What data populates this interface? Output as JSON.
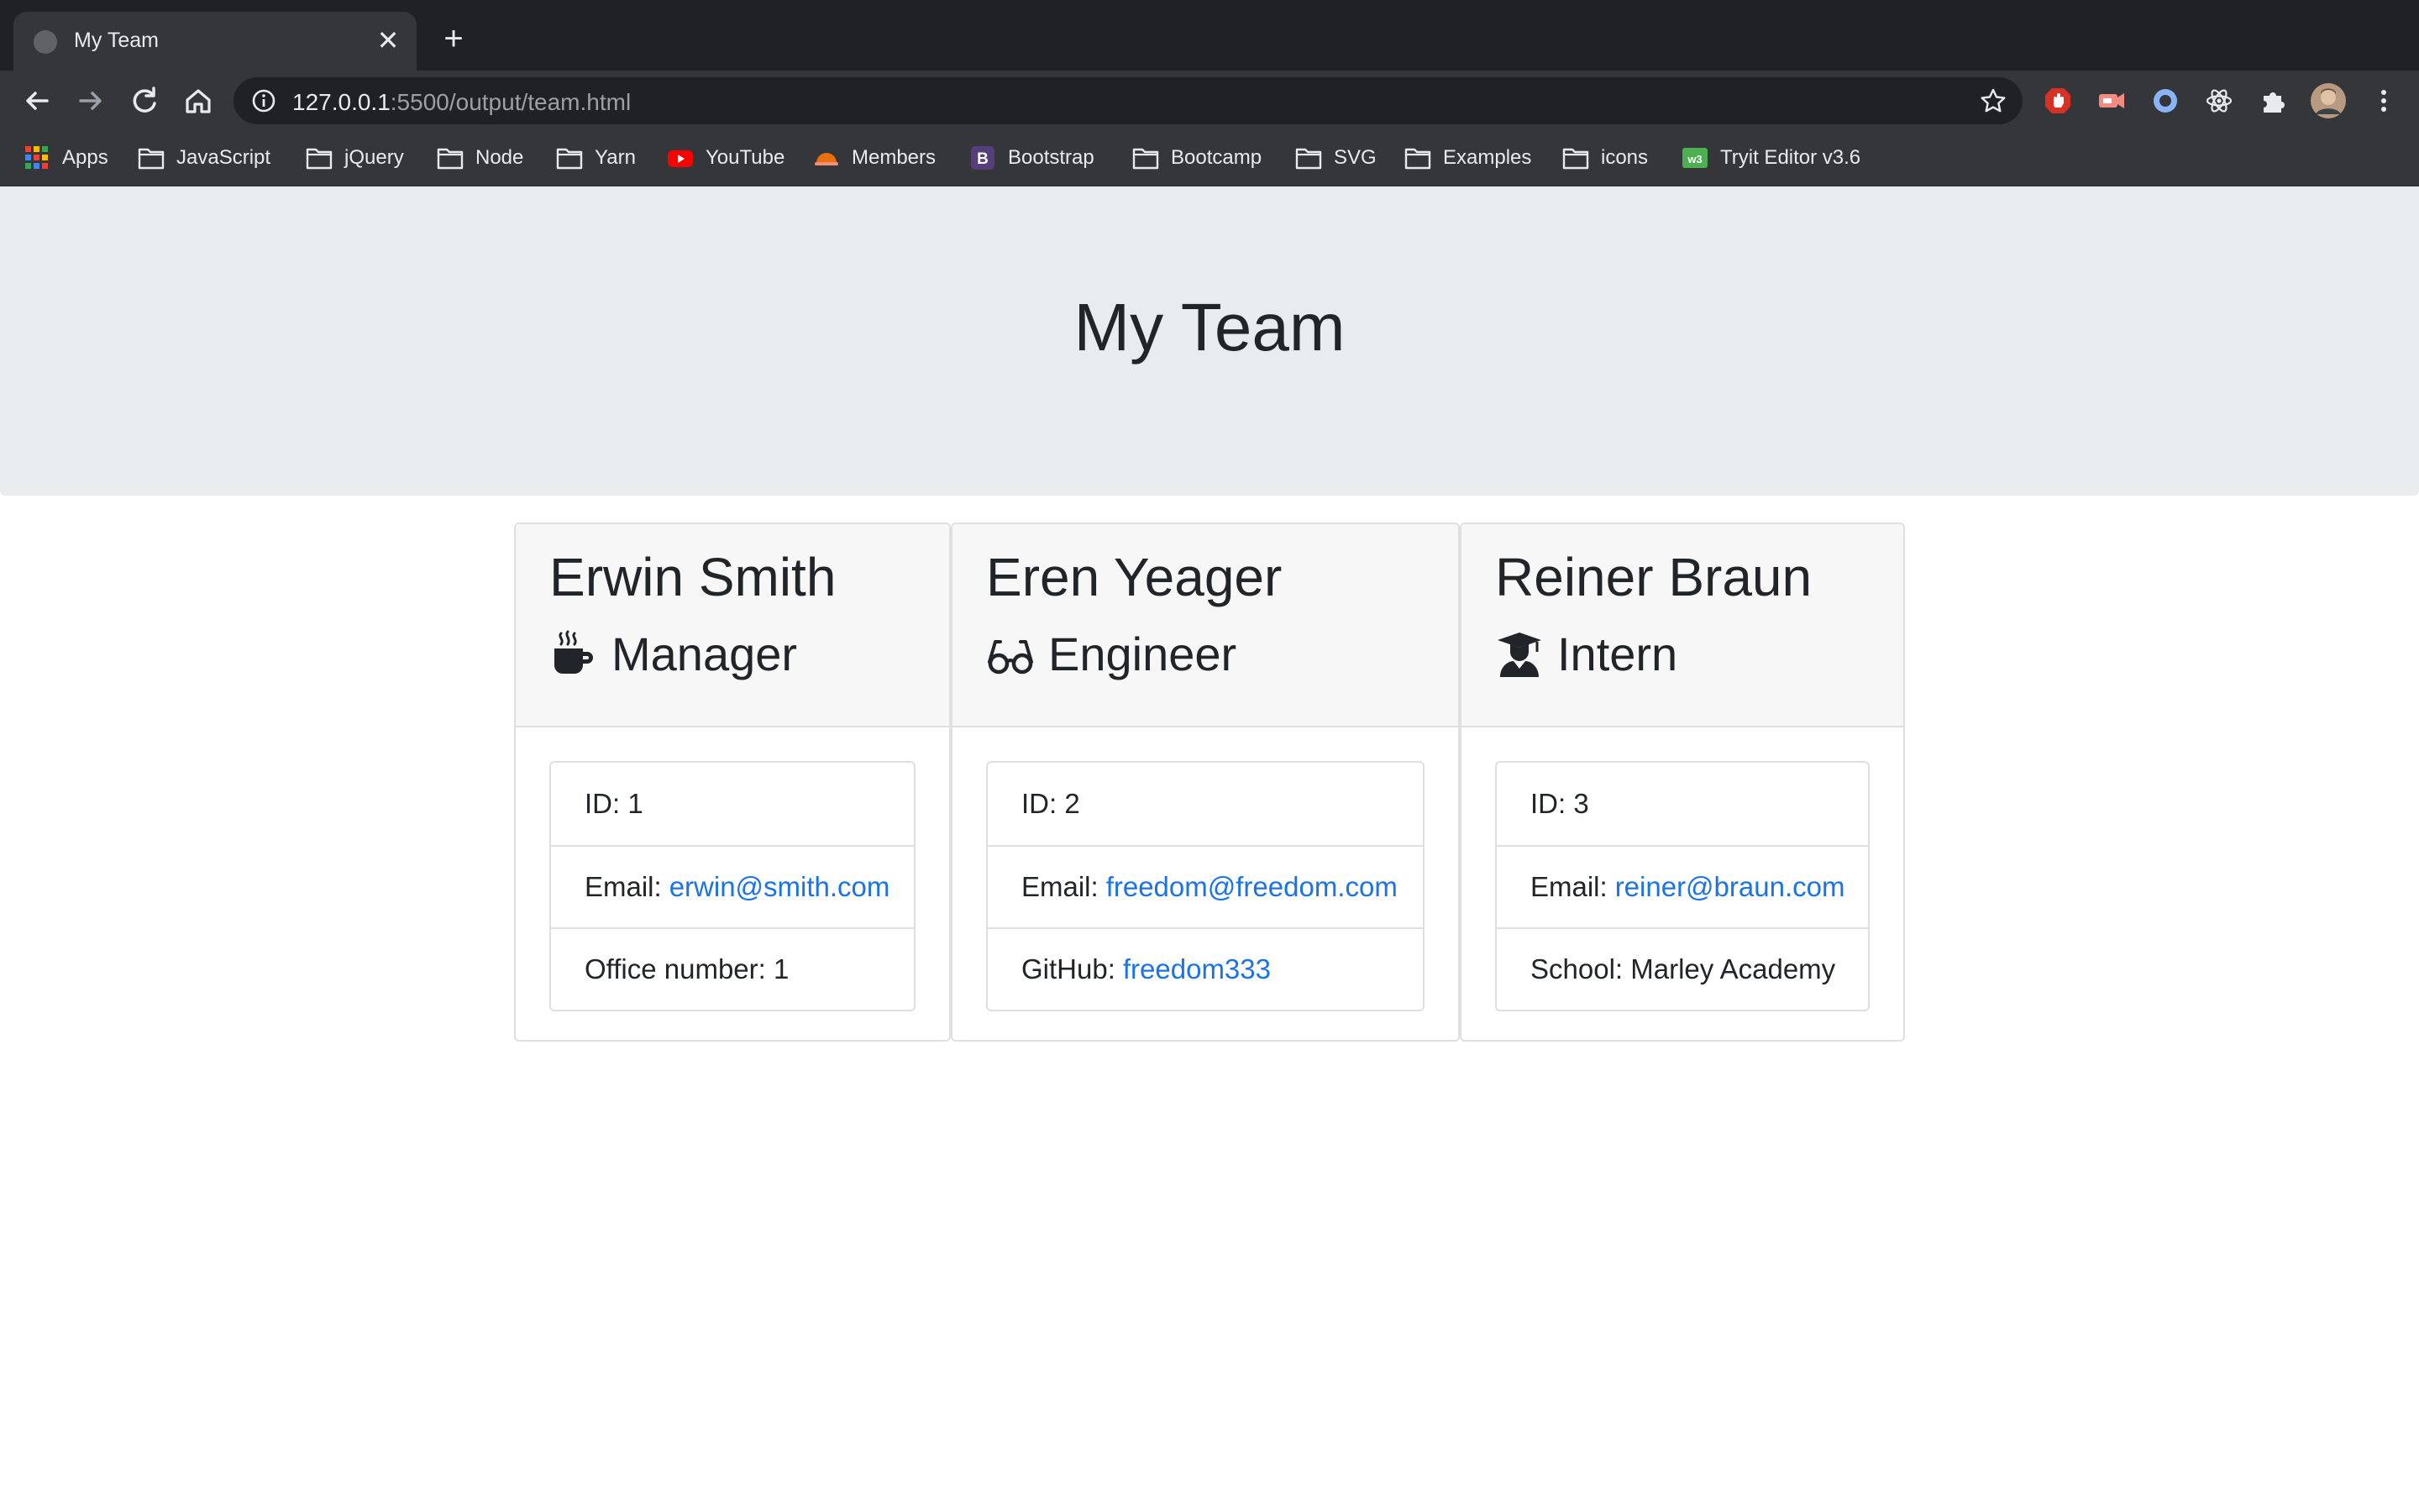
{
  "browser": {
    "tab_title": "My Team",
    "url_host": "127.0.0.1",
    "url_rest": ":5500/output/team.html",
    "bookmarks": [
      {
        "label": "Apps",
        "icon": "apps-grid-icon"
      },
      {
        "label": "JavaScript",
        "icon": "folder-icon"
      },
      {
        "label": "jQuery",
        "icon": "folder-icon"
      },
      {
        "label": "Node",
        "icon": "folder-icon"
      },
      {
        "label": "Yarn",
        "icon": "folder-icon"
      },
      {
        "label": "YouTube",
        "icon": "youtube-icon"
      },
      {
        "label": "Members",
        "icon": "helmet-icon"
      },
      {
        "label": "Bootstrap",
        "icon": "bootstrap-icon"
      },
      {
        "label": "Bootcamp",
        "icon": "folder-icon"
      },
      {
        "label": "SVG",
        "icon": "folder-icon"
      },
      {
        "label": "Examples",
        "icon": "folder-icon"
      },
      {
        "label": "icons",
        "icon": "folder-icon"
      },
      {
        "label": "Tryit Editor v3.6",
        "icon": "w3schools-icon"
      }
    ]
  },
  "page": {
    "heading": "My Team",
    "members": [
      {
        "name": "Erwin Smith",
        "role": "Manager",
        "role_icon": "mug-icon",
        "id_label": "ID:",
        "id_value": "1",
        "email_label": "Email:",
        "email": "erwin@smith.com",
        "extra_label": "Office number:",
        "extra_value": "1"
      },
      {
        "name": "Eren Yeager",
        "role": "Engineer",
        "role_icon": "glasses-icon",
        "id_label": "ID:",
        "id_value": "2",
        "email_label": "Email:",
        "email": "freedom@freedom.com",
        "extra_label": "GitHub:",
        "extra_value": "freedom333"
      },
      {
        "name": "Reiner Braun",
        "role": "Intern",
        "role_icon": "graduate-icon",
        "id_label": "ID:",
        "id_value": "3",
        "email_label": "Email:",
        "email": "reiner@braun.com",
        "extra_label": "School:",
        "extra_value": "Marley Academy"
      }
    ]
  },
  "colors": {
    "chrome_dark": "#202124",
    "chrome_toolbar": "#35363a",
    "jumbotron_bg": "#e9ecef",
    "link": "#1a73e8"
  }
}
